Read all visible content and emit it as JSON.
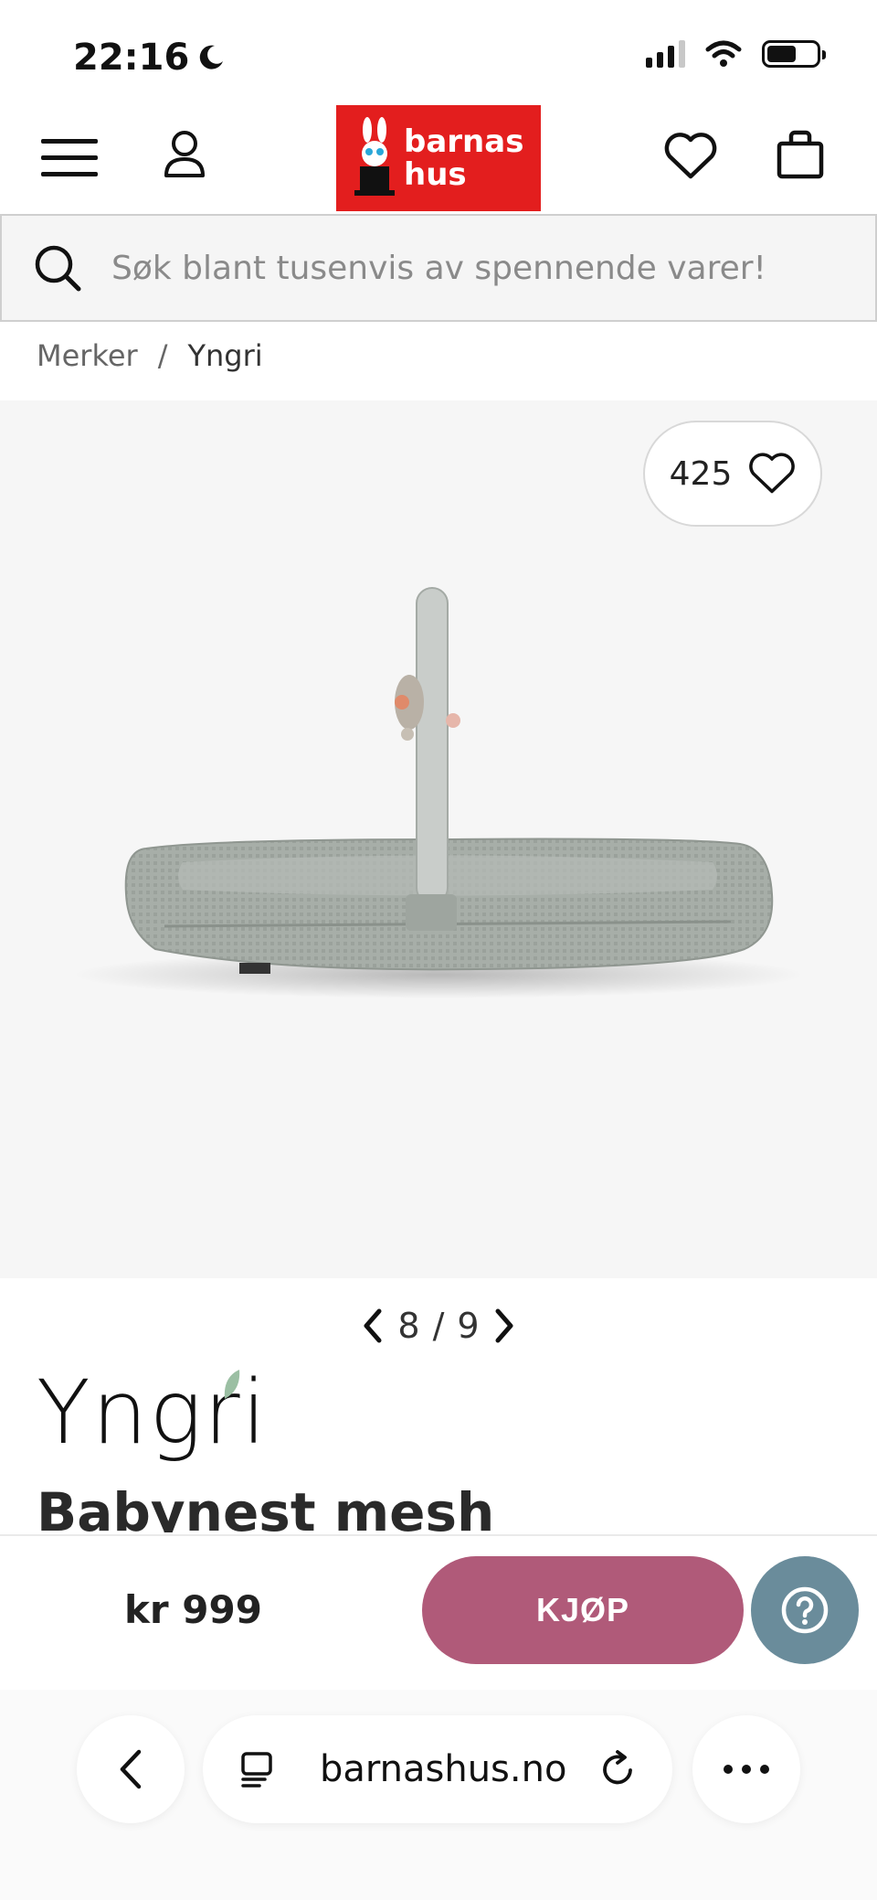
{
  "status_bar": {
    "time": "22:16"
  },
  "header": {
    "logo_line1": "barnas",
    "logo_line2": "hus"
  },
  "search": {
    "placeholder": "Søk blant tusenvis av spennende varer!"
  },
  "breadcrumb": {
    "items": [
      "Merker",
      "Yngri"
    ],
    "separator": "/"
  },
  "product": {
    "favorite_count": "425",
    "image_index": "8",
    "image_separator": "/",
    "image_total": "9",
    "brand_logo": "Yngri",
    "title": "Babynest mesh",
    "price": "kr 999",
    "buy_label": "KJØP"
  },
  "browser": {
    "url": "barnashus.no"
  },
  "colors": {
    "logo_red": "#e31e1e",
    "buy_button": "#b05a79",
    "help_button": "#6a8c9b",
    "product_bg": "#f6f6f6"
  },
  "icons": [
    "moon-icon",
    "signal-icon",
    "wifi-icon",
    "battery-icon",
    "menu-icon",
    "user-icon",
    "heart-icon",
    "bag-icon",
    "search-icon",
    "chevron-left-icon",
    "chevron-right-icon",
    "help-icon",
    "tabs-icon",
    "reload-icon",
    "more-icon"
  ]
}
